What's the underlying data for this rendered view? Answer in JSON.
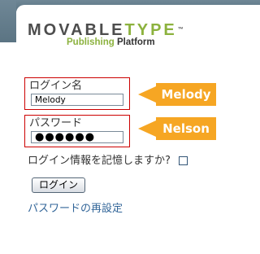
{
  "logo": {
    "wordmark_before": "MOVABLE",
    "wordmark_after": "TYPE",
    "trademark": "™",
    "sub_green": "Publishing",
    "sub_dark": "Platform"
  },
  "login_form": {
    "username_label": "ログイン名",
    "username_value": "Melody",
    "password_label": "パスワード",
    "password_value": "●●●●●●",
    "remember_label": "ログイン情報を記憶しますか?",
    "remember_checked": false,
    "submit_label": "ログイン",
    "reset_link": "パスワードの再設定"
  },
  "callouts": {
    "username": "Melody",
    "password": "Nelson"
  },
  "colors": {
    "header_bar": "#6f8796",
    "logo_accent": "#8cb23e",
    "highlight_border": "#cc0000",
    "callout_fill": "#f6a623",
    "link": "#336699"
  }
}
